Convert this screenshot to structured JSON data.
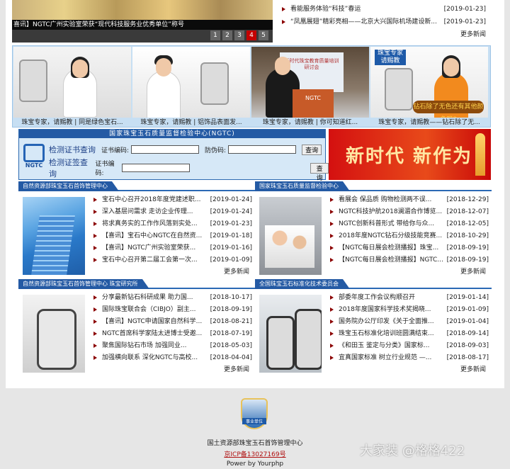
{
  "slider": {
    "caption": "喜讯】NGTC广州实验室荣获“现代科技服务业优秀单位”称号",
    "pages": [
      "1",
      "2",
      "3",
      "4",
      "5"
    ],
    "active_page": "4"
  },
  "top_news": {
    "items": [
      {
        "title": "看能服务体验“科技”春运",
        "date": "[2019-01-23]"
      },
      {
        "title": "“凤凰展翅”精彩亮相——北京大兴国际机场建设新...",
        "date": "[2019-01-23]"
      }
    ],
    "more": "更多新闻"
  },
  "videos": [
    {
      "caption": "珠宝专家，请赐教 | 同是绿色宝石..."
    },
    {
      "caption": "珠宝专家，请赐教 | 铝饰品表面发..."
    },
    {
      "caption": "珠宝专家，请赐教 | 你可知道红..."
    },
    {
      "caption": "珠宝专家，请赐教——钻石除了无..."
    }
  ],
  "video_art": {
    "logo": "珠宝专家 请赐教",
    "bubble": "钻石除了无色还有其他颜色吗?",
    "podium": "NGTC",
    "screen": "新时代珠宝教育质量培训研讨会"
  },
  "query": {
    "title": "国家珠宝玉石质量监督检验中心(NGTC)",
    "logo_label": "NGTC",
    "cert_label": "检测证书查询",
    "cert_no_label": "证书编码:",
    "anti_fake_label": "防伪码:",
    "tag_label": "检测证签查询",
    "tag_no_label": "证书编码:",
    "button": "查询"
  },
  "banner": {
    "text": "新时代 新作为"
  },
  "sections": {
    "s1": {
      "title": "自然资源部珠宝玉石首饰管理中心",
      "items": [
        {
          "title": "宝石中心召开2018年度党建述职...",
          "date": "[2019-01-24]"
        },
        {
          "title": "深入基层问需求 走访企业传理...",
          "date": "[2019-01-24]"
        },
        {
          "title": "将求真务实的工作作风落到实处...",
          "date": "[2019-01-23]"
        },
        {
          "title": "【喜讯】宝石中心NGTC在自然资...",
          "date": "[2019-01-18]"
        },
        {
          "title": "【喜讯】NGTC广州实验室荣获...",
          "date": "[2019-01-16]"
        },
        {
          "title": "宝石中心召开第二届工会第一次...",
          "date": "[2019-01-09]"
        }
      ],
      "more": "更多新闻"
    },
    "s2": {
      "title": "国家珠宝玉石质量监督检验中心",
      "items": [
        {
          "title": "看展会 保品质 购物检测两不误...",
          "date": "[2018-12-29]"
        },
        {
          "title": "NGTC科技护航2018澜湄合作博览...",
          "date": "[2018-12-07]"
        },
        {
          "title": "NGTC创新科普形式 带给你与众...",
          "date": "[2018-12-05]"
        },
        {
          "title": "2018年度NGTC钻石分级技能竞赛...",
          "date": "[2018-10-29]"
        },
        {
          "title": "【NGTC每日展会检测播报】珠宝...",
          "date": "[2018-09-19]"
        },
        {
          "title": "【NGTC每日展会检测播报】NGTC...",
          "date": "[2018-09-19]"
        }
      ],
      "more": "更多新闻"
    },
    "s3": {
      "title": "自然资源部珠宝玉石首饰管理中心 珠宝研究所",
      "items": [
        {
          "title": "分享最新钻石科研成果 助力国...",
          "date": "[2018-10-17]"
        },
        {
          "title": "国际珠宝联合会（CIBJO）副主...",
          "date": "[2018-09-19]"
        },
        {
          "title": "【喜讯】NGTC申请国家自然科学...",
          "date": "[2018-08-21]"
        },
        {
          "title": "NGTC首席科学家陆太进博士受邀...",
          "date": "[2018-07-19]"
        },
        {
          "title": "聚焦国际钻石市场 加强同业...",
          "date": "[2018-05-03]"
        },
        {
          "title": "加强横向联系 深化NGTC与高校...",
          "date": "[2018-04-04]"
        }
      ],
      "more": "更多新闻"
    },
    "s4": {
      "title": "全国珠宝玉石标准化技术委员会",
      "items": [
        {
          "title": "部委年度工作会议构顺召开",
          "date": "[2019-01-14]"
        },
        {
          "title": "2018年度国家科学技术奖揭晓...",
          "date": "[2019-01-09]"
        },
        {
          "title": "国务院办公厅印发《关于全面推...",
          "date": "[2019-01-04]"
        },
        {
          "title": "珠宝玉石标准化培训班圆满结束...",
          "date": "[2018-09-14]"
        },
        {
          "title": "《和田玉 鉴定与分类》国家标...",
          "date": "[2018-09-03]"
        },
        {
          "title": "宜真国家标准 树立行业规范 —...",
          "date": "[2018-08-17]"
        }
      ],
      "more": "更多新闻"
    }
  },
  "footer": {
    "emblem_label": "事业单位",
    "org": "国土资源部珠宝玉石首饰管理中心",
    "icp": "京ICP备13027169号",
    "powered": "Power by Yourphp",
    "watermark": "大家装 @格格422"
  }
}
